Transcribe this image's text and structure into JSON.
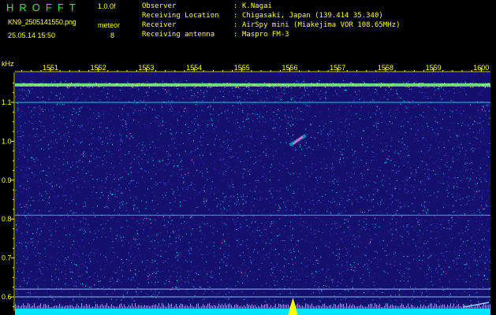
{
  "header": {
    "app_name": "HROFFT",
    "version": "1.0.0f",
    "file_name": "KN9_2505141550.png",
    "meteor_label": "meteor",
    "meteor_count": "8",
    "date_time": "25.05.14 15:50",
    "info": [
      {
        "label": "Observer",
        "value": "K.Nagai"
      },
      {
        "label": "Receiving Location",
        "value": "Chigasaki, Japan (139.414 35.340)"
      },
      {
        "label": "Receiver",
        "value": "AirSpy mini (Miakejima VOR 108.65MHz)"
      },
      {
        "label": "Receiving antenna",
        "value": "Maspro FM-3"
      }
    ]
  },
  "spectrogram": {
    "unit_label": "kHz",
    "x_ticks": [
      "1551",
      "1552",
      "1553",
      "1554",
      "1555",
      "1556",
      "1557",
      "1558",
      "1559",
      "1600"
    ],
    "y_ticks": [
      "1.1",
      "1.0",
      "0.9",
      "0.8",
      "0.7",
      "0.6"
    ],
    "y_tick_values": [
      1.1,
      1.0,
      0.9,
      0.8,
      0.7,
      0.6
    ],
    "x_ticks_per_label": 5,
    "carrier_freq_khz": 1.145,
    "persistent_lines_khz": [
      1.1,
      0.81,
      0.62,
      0.6
    ],
    "meteor_echo": {
      "start_time": "15:56:00",
      "end_time": "15:56:20",
      "freq_start_khz": 0.99,
      "freq_end_khz": 1.015
    },
    "colors": {
      "background": "#14116e",
      "noise_low": "#3030c8",
      "noise_mid": "#5a7cff",
      "noise_high": "#00ffff",
      "carrier": "#7fff7f",
      "echo": "#ff66cc",
      "text": "#ffff00",
      "spectrum_base": "#00e5ff",
      "spectrum_peak": "#ffff00"
    }
  }
}
